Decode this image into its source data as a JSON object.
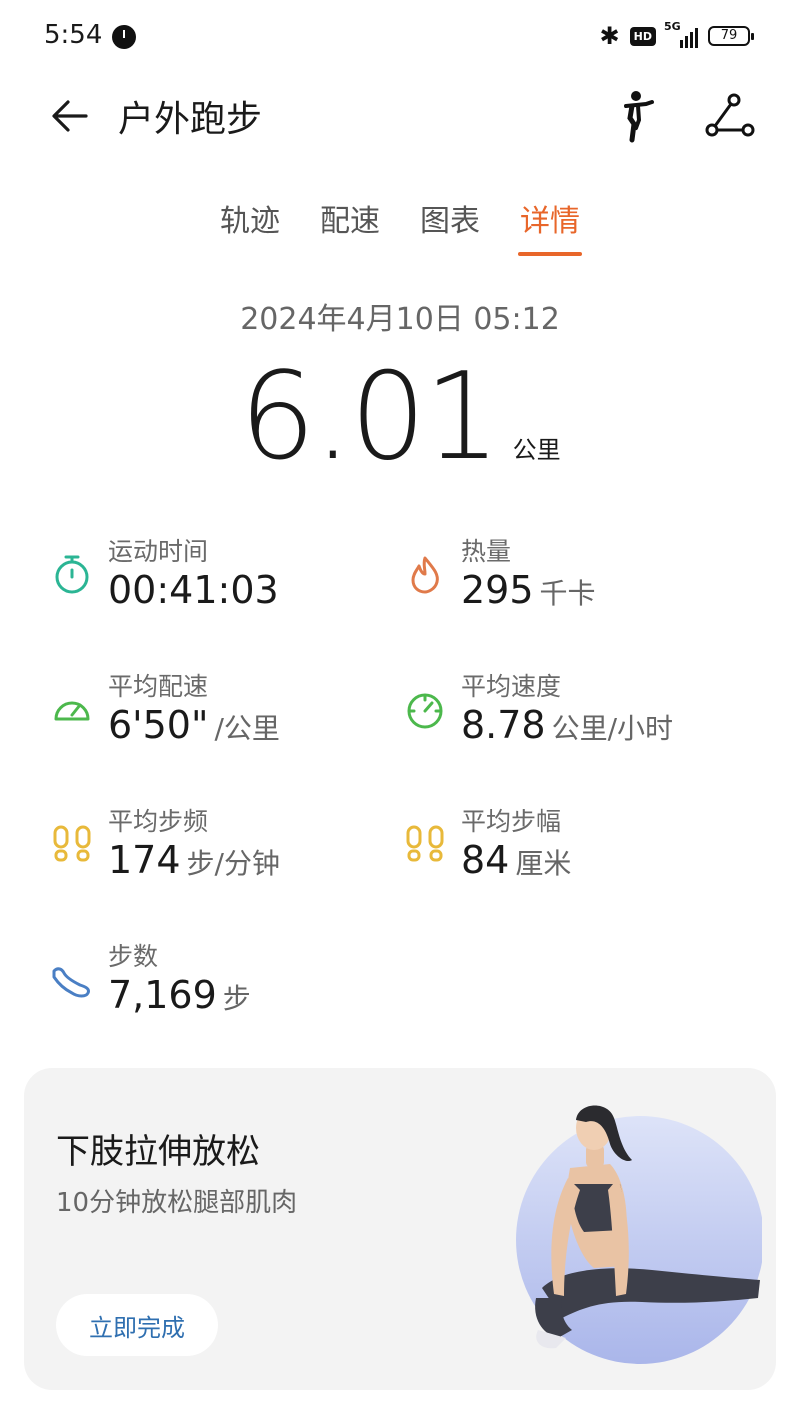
{
  "status_bar": {
    "time": "5:54",
    "bluetooth_icon": "bluetooth-icon",
    "hd_badge": "HD",
    "network": "5G",
    "battery": "79"
  },
  "header": {
    "title": "户外跑步",
    "back_icon": "arrow-left-icon",
    "actions": [
      "runner-pose-icon",
      "route-share-icon"
    ]
  },
  "tabs": [
    {
      "label": "轨迹",
      "active": false
    },
    {
      "label": "配速",
      "active": false
    },
    {
      "label": "图表",
      "active": false
    },
    {
      "label": "详情",
      "active": true
    }
  ],
  "accent_color": "#e8662a",
  "summary": {
    "datetime": "2024年4月10日 05:12",
    "distance": "6.01",
    "distance_unit": "公里"
  },
  "metrics": {
    "duration": {
      "label": "运动时间",
      "value": "00:41:03",
      "unit": "",
      "icon": "stopwatch-icon",
      "color": "#2bb594"
    },
    "calories": {
      "label": "热量",
      "value": "295",
      "unit": "千卡",
      "icon": "flame-icon",
      "color": "#e07a4a"
    },
    "avg_pace": {
      "label": "平均配速",
      "value": "6'50\"",
      "unit": "/公里",
      "icon": "speedometer-icon",
      "color": "#4cb84c"
    },
    "avg_speed": {
      "label": "平均速度",
      "value": "8.78",
      "unit": "公里/小时",
      "icon": "gauge-icon",
      "color": "#4cb84c"
    },
    "avg_cadence": {
      "label": "平均步频",
      "value": "174",
      "unit": "步/分钟",
      "icon": "footprints-icon",
      "color": "#e8b93a"
    },
    "avg_stride": {
      "label": "平均步幅",
      "value": "84",
      "unit": "厘米",
      "icon": "footprints-icon",
      "color": "#e8b93a"
    },
    "steps": {
      "label": "步数",
      "value": "7,169",
      "unit": "步",
      "icon": "shoe-icon",
      "color": "#4a7fc4"
    }
  },
  "recommendation": {
    "title": "下肢拉伸放松",
    "subtitle": "10分钟放松腿部肌肉",
    "button": "立即完成",
    "illustration": "stretching-woman-illustration"
  }
}
